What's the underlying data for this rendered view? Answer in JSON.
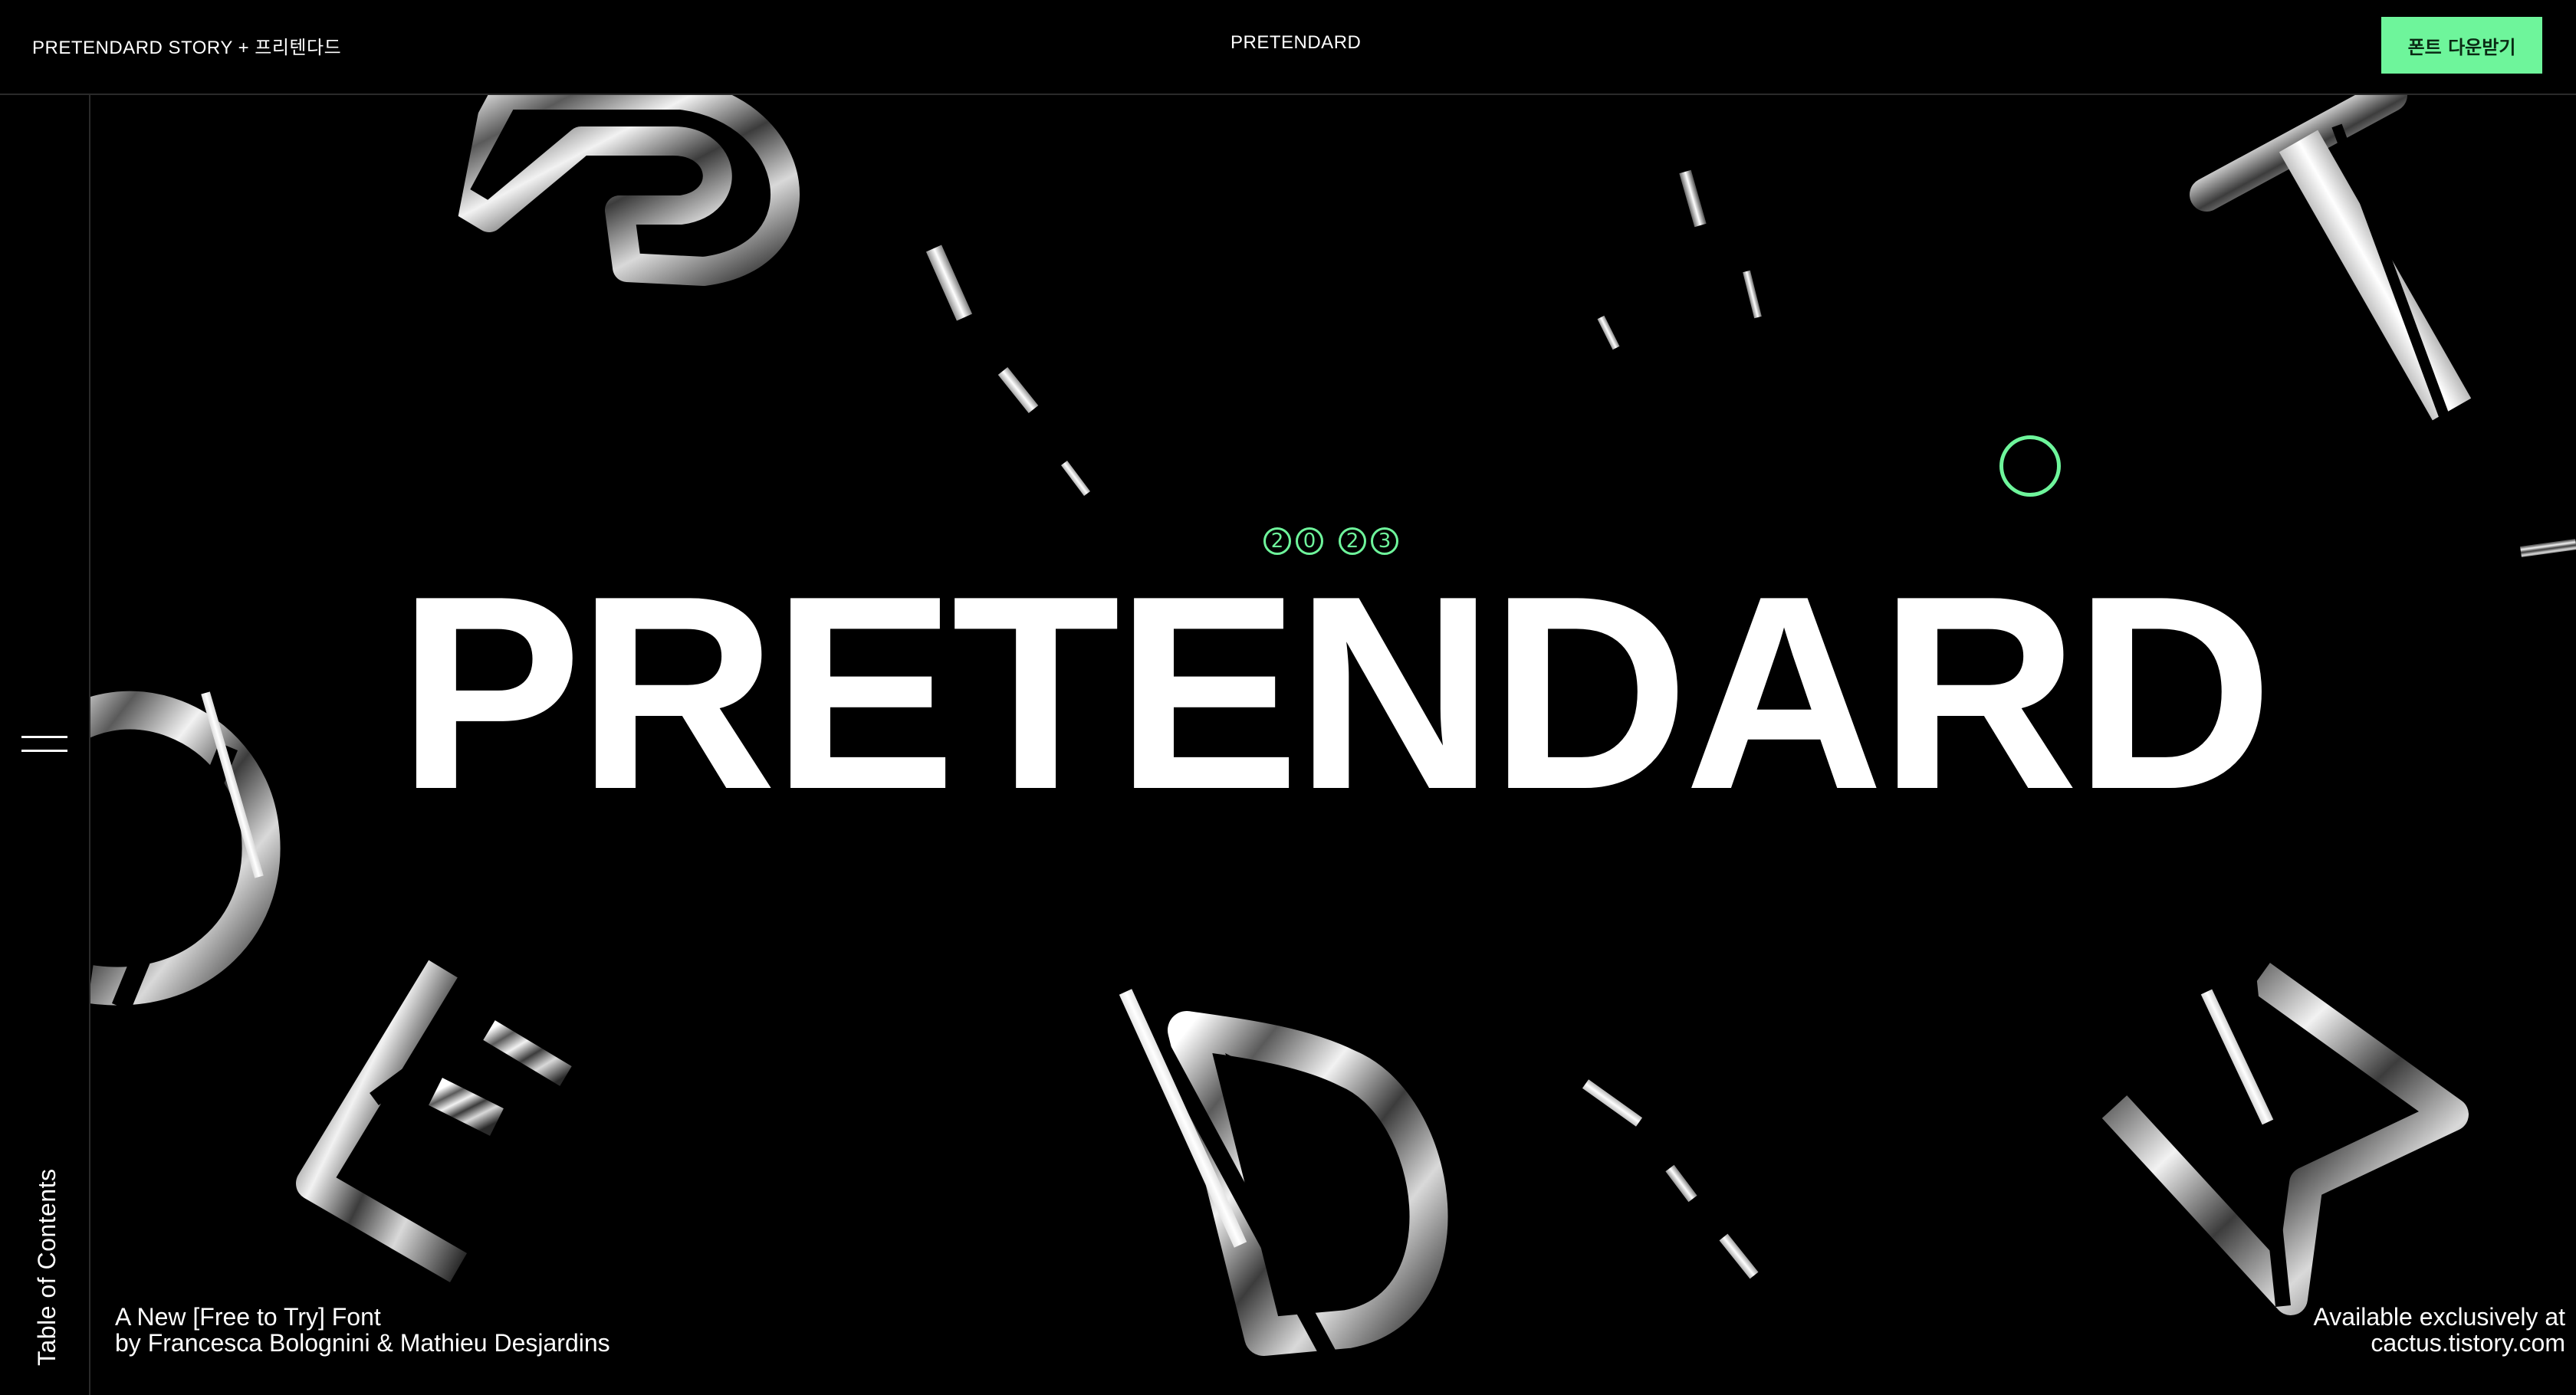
{
  "header": {
    "brand": "PRETENDARD STORY + 프리텐다드",
    "title": "PRETENDARD",
    "download_button": "폰트 다운받기"
  },
  "sidebar": {
    "menu_icon": "hamburger-menu-icon",
    "toc_label": "Table of Contents"
  },
  "hero": {
    "year_digits": [
      "2",
      "0",
      "2",
      "3"
    ],
    "headline": "PRETENDARD",
    "tagline_line1": "A New [Free to Try] Font",
    "tagline_line2": "by Francesca Bolognini & Mathieu Desjardins",
    "availability_line1": "Available exclusively at",
    "availability_line2": "cactus.tistory.com"
  },
  "colors": {
    "background": "#000000",
    "accent": "#6ef59b",
    "text": "#ffffff"
  }
}
